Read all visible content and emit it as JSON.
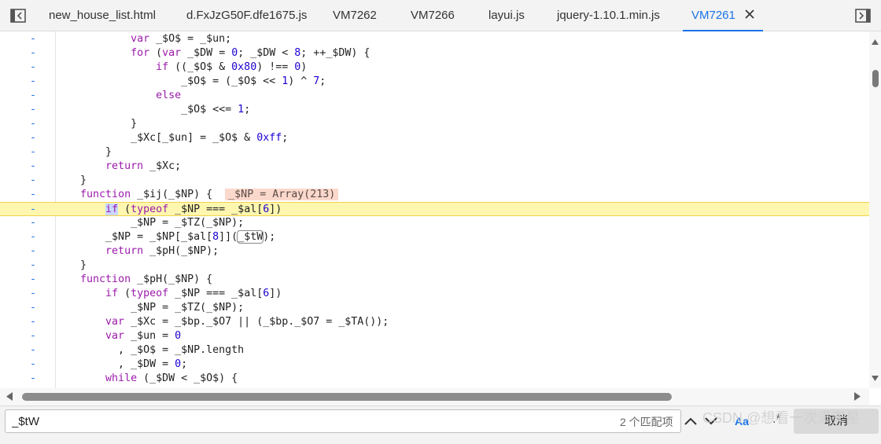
{
  "tabs": [
    {
      "label": "new_house_list.html",
      "active": false
    },
    {
      "label": "d.FxJzG50F.dfe1675.js",
      "active": false
    },
    {
      "label": "VM7262",
      "active": false
    },
    {
      "label": "VM7266",
      "active": false
    },
    {
      "label": "layui.js",
      "active": false
    },
    {
      "label": "jquery-1.10.1.min.js",
      "active": false
    },
    {
      "label": "VM7261",
      "active": true
    }
  ],
  "gutter_mark": "-",
  "code_lines": [
    {
      "text": "            var _$O$ = _$un;"
    },
    {
      "text": "            for (var _$DW = 0; _$DW < 8; ++_$DW) {"
    },
    {
      "text": "                if ((_$O$ & 0x80) !== 0)"
    },
    {
      "text": "                    _$O$ = (_$O$ << 1) ^ 7;"
    },
    {
      "text": "                else"
    },
    {
      "text": "                    _$O$ <<= 1;"
    },
    {
      "text": "            }"
    },
    {
      "text": "            _$Xc[_$un] = _$O$ & 0xff;"
    },
    {
      "text": "        }"
    },
    {
      "text": "        return _$Xc;"
    },
    {
      "text": "    }"
    },
    {
      "text": "    function _$ij(_$NP) {  ",
      "inline": "_$NP = Array(213)"
    },
    {
      "text": "        if (typeof _$NP === _$al[6])",
      "exec": true
    },
    {
      "text": "            _$NP = _$TZ(_$NP);"
    },
    {
      "text": "        _$NP = _$NP[_$al[8]](_$tW);"
    },
    {
      "text": "        return _$pH(_$NP);"
    },
    {
      "text": "    }"
    },
    {
      "text": "    function _$pH(_$NP) {"
    },
    {
      "text": "        if (typeof _$NP === _$al[6])"
    },
    {
      "text": "            _$NP = _$TZ(_$NP);"
    },
    {
      "text": "        var _$Xc = _$bp._$O7 || (_$bp._$O7 = _$TA());"
    },
    {
      "text": "        var _$un = 0"
    },
    {
      "text": "          , _$O$ = _$NP.length"
    },
    {
      "text": "          , _$DW = 0;"
    },
    {
      "text": "        while (_$DW < _$O$) {"
    }
  ],
  "search": {
    "value": "_$tW",
    "match_count": "2 个匹配项",
    "case_label": "Aa",
    "regex_label": ".*",
    "cancel_label": "取消"
  },
  "watermark": "CSDN @想看一次满天星",
  "colors": {
    "accent": "#1a73e8",
    "exec_line": "#fff7b0",
    "keyword": "#9b1bab",
    "number": "#1c00cf"
  }
}
